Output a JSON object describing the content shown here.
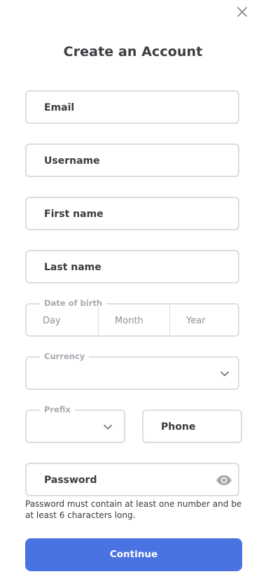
{
  "form": {
    "title": "Create an Account",
    "email_placeholder": "Email",
    "username_placeholder": "Username",
    "first_name_placeholder": "First name",
    "last_name_placeholder": "Last name",
    "dob": {
      "legend": "Date of birth",
      "day": "Day",
      "month": "Month",
      "year": "Year"
    },
    "currency": {
      "legend": "Currency",
      "value": ""
    },
    "prefix": {
      "legend": "Prefix",
      "value": ""
    },
    "phone_placeholder": "Phone",
    "password_placeholder": "Password",
    "password_hint": "Password must contain at least one number and be at least 6 characters long.",
    "continue_label": "Continue"
  },
  "icons": {
    "close": "close-icon",
    "chevron": "chevron-down-icon",
    "eye": "eye-icon"
  },
  "colors": {
    "accent": "#4a72e0",
    "border": "#dcdce3",
    "text": "#3a3a3f",
    "muted": "#a9a9b1"
  }
}
